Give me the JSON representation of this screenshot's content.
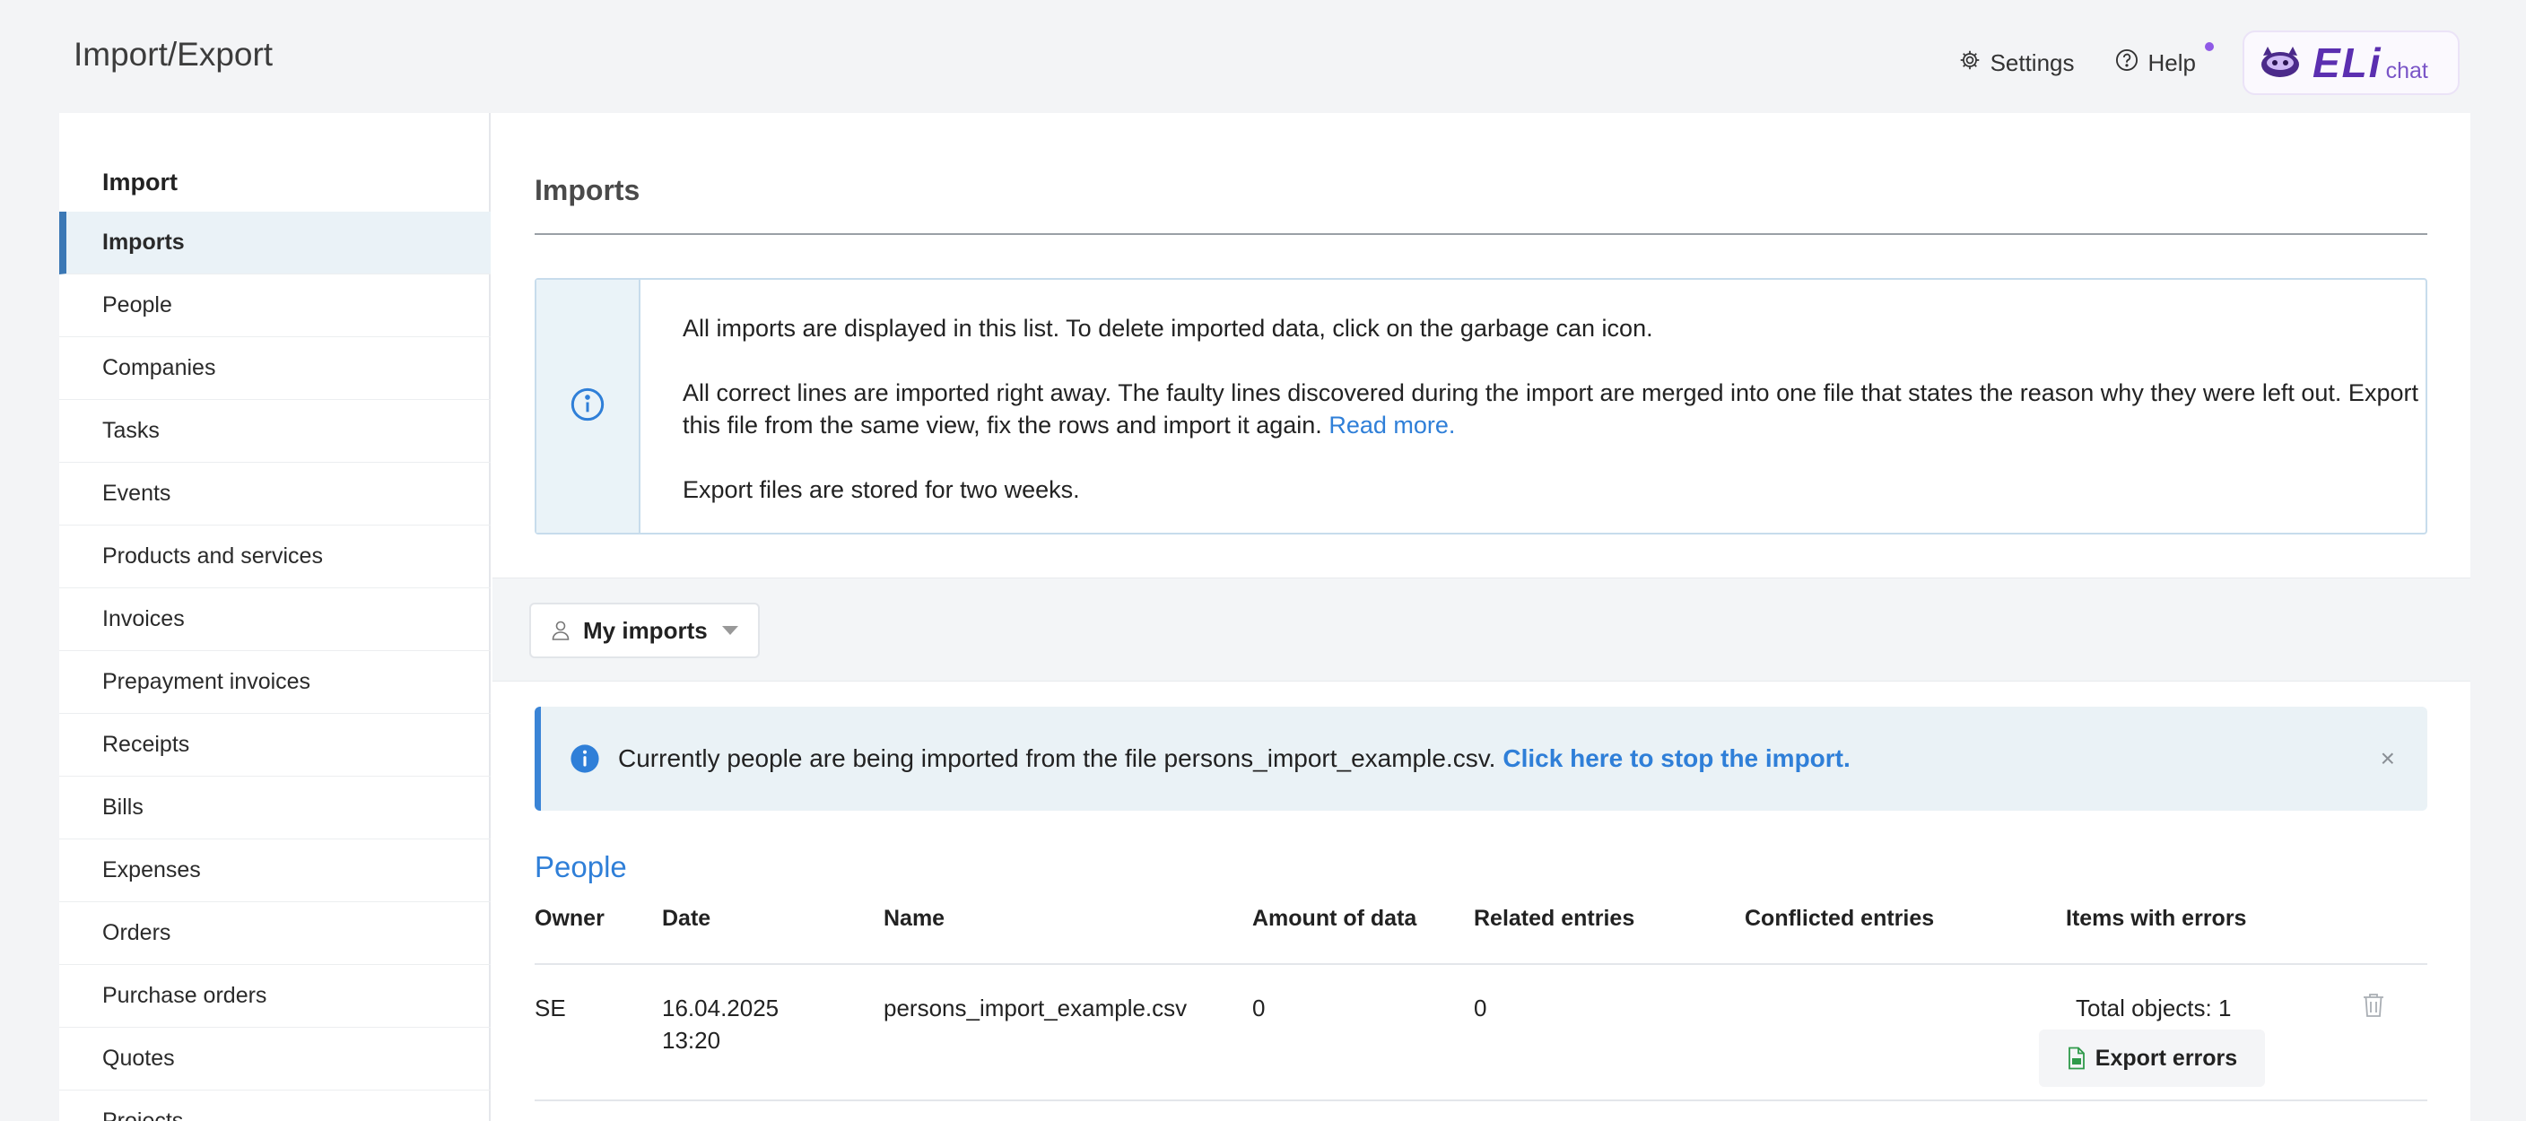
{
  "page": {
    "title": "Import/Export"
  },
  "header": {
    "settings_label": "Settings",
    "help_label": "Help",
    "eli_logo": "ELi",
    "eli_suffix": "chat",
    "accent_color": "#8f59e6"
  },
  "sidebar": {
    "heading": "Import",
    "items": [
      {
        "label": "Imports",
        "active": true
      },
      {
        "label": "People"
      },
      {
        "label": "Companies"
      },
      {
        "label": "Tasks"
      },
      {
        "label": "Events"
      },
      {
        "label": "Products and services"
      },
      {
        "label": "Invoices"
      },
      {
        "label": "Prepayment invoices"
      },
      {
        "label": "Receipts"
      },
      {
        "label": "Bills"
      },
      {
        "label": "Expenses"
      },
      {
        "label": "Orders"
      },
      {
        "label": "Purchase orders"
      },
      {
        "label": "Quotes"
      },
      {
        "label": "Projects"
      }
    ]
  },
  "main": {
    "title": "Imports",
    "info": {
      "line1": "All imports are displayed in this list. To delete imported data, click on the garbage can icon.",
      "line2": "All correct lines are imported right away. The faulty lines discovered during the import are merged into one file that states the reason why they were left out. Export this file from the same view, fix the rows and import it again.",
      "read_more": "Read more.",
      "line3": "Export files are stored for two weeks."
    },
    "filter": {
      "label": "My imports"
    },
    "banner": {
      "text": "Currently people are being imported from the file persons_import_example.csv.",
      "link": "Click here to stop the import.",
      "close": "×"
    },
    "section": "People",
    "table": {
      "headers": [
        "Owner",
        "Date",
        "Name",
        "Amount of data",
        "Related entries",
        "Conflicted entries",
        "Items with errors"
      ],
      "rows": [
        {
          "owner": "SE",
          "date": "16.04.2025",
          "time": "13:20",
          "name": "persons_import_example.csv",
          "amount": "0",
          "related": "0",
          "conflicted": "",
          "errors": "Total objects: 1",
          "export_label": "Export errors"
        }
      ]
    }
  }
}
